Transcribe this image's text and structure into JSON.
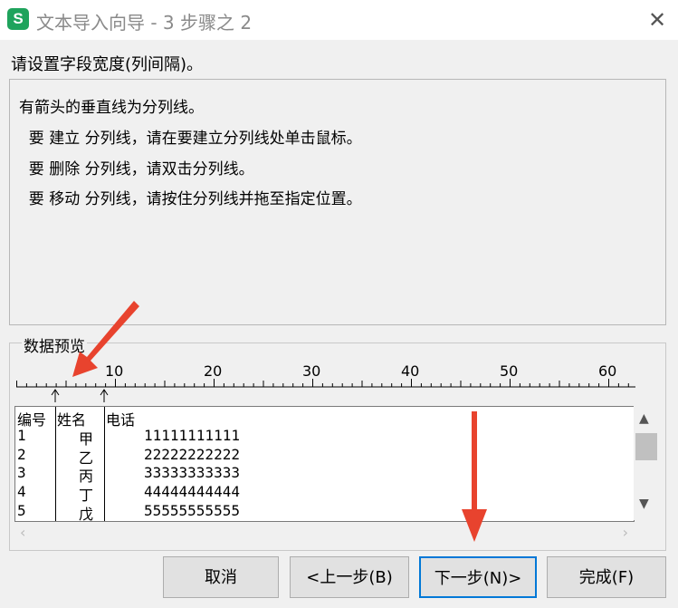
{
  "window": {
    "app_icon_letter": "S",
    "title": "文本导入向导 - 3 步骤之 2",
    "close_glyph": "✕"
  },
  "instruction": "请设置字段宽度(列间隔)。",
  "info_lines": [
    "有箭头的垂直线为分列线。",
    "  要 建立 分列线，请在要建立分列线处单击鼠标。",
    "  要 删除 分列线，请双击分列线。",
    "  要 移动 分列线，请按住分列线并拖至指定位置。"
  ],
  "preview": {
    "legend": "数据预览",
    "ruler_labels": [
      "10",
      "20",
      "30",
      "40",
      "50",
      "60"
    ],
    "columns": {
      "col1": [
        "编号",
        "1",
        "2",
        "3",
        "4",
        "5"
      ],
      "col2": [
        "姓名",
        "甲",
        "乙",
        "丙",
        "丁",
        "戊"
      ],
      "col3": [
        "电话",
        "11111111111",
        "22222222222",
        "33333333333",
        "44444444444",
        "55555555555"
      ]
    }
  },
  "buttons": {
    "cancel": "取消",
    "back": "<上一步(B)",
    "next": "下一步(N)>",
    "finish": "完成(F)"
  },
  "colors": {
    "app_icon": "#1fa35c",
    "annotation_arrow": "#e8432e",
    "primary_border": "#0078d7"
  }
}
